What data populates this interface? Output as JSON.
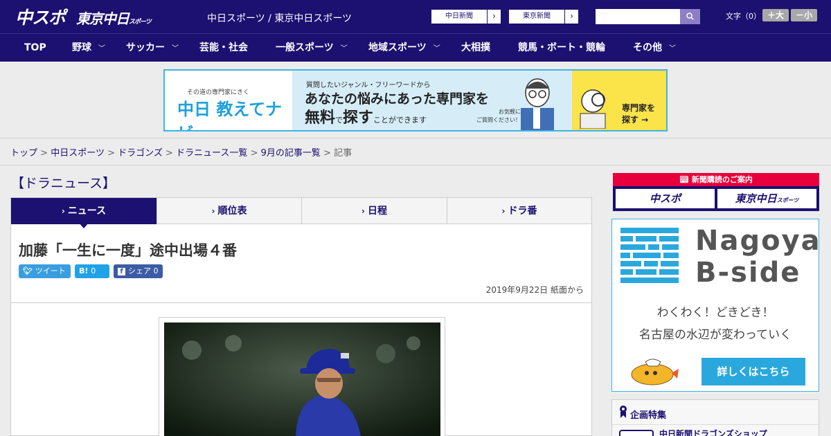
{
  "header": {
    "logo_chuspo": "中スポ",
    "logo_tokyo": "東京中日",
    "logo_tokyo_small": "スポーツ",
    "tagline": "中日スポーツ / 東京中日スポーツ",
    "btn_chunichi": "中日新聞",
    "btn_tokyo": "東京新聞",
    "search_placeholder": "",
    "font_size_label": "文字（0）",
    "font_plus": "＋大",
    "font_minus": "－小"
  },
  "nav": {
    "items": [
      {
        "label": "TOP"
      },
      {
        "label": "野球"
      },
      {
        "label": "サッカー"
      },
      {
        "label": "芸能・社会"
      },
      {
        "label": "一般スポーツ"
      },
      {
        "label": "地域スポーツ"
      },
      {
        "label": "大相撲"
      },
      {
        "label": "競馬・ボート・競輪"
      },
      {
        "label": "その他"
      }
    ]
  },
  "ad": {
    "sub": "その道の専門家にきく",
    "navi": "中日 教えてナビ",
    "question": "質問したいジャンル・フリーワードから",
    "headline1": "あなたの悩みにあった専門家を",
    "headline2_a": "無料",
    "headline2_b": "で",
    "headline2_c": "探す",
    "headline2_d": "ことができます",
    "kigaru1": "お気軽に",
    "kigaru2": "ご質問ください！",
    "explore1": "専門家を",
    "explore2": "探す →"
  },
  "breadcrumb": {
    "items": [
      "トップ",
      "中日スポーツ",
      "ドラゴンズ",
      "ドラニュース一覧",
      "9月の記事一覧"
    ],
    "current": "記事",
    "sep": ">"
  },
  "section_title": "【ドラニュース】",
  "tabs": [
    {
      "label": "ニュース"
    },
    {
      "label": "順位表"
    },
    {
      "label": "日程"
    },
    {
      "label": "ドラ番"
    }
  ],
  "article": {
    "title": "加藤「一生に一度」途中出場４番",
    "tweet": "ツイート",
    "hatena": "0",
    "share": "シェア 0",
    "date": "2019年9月22日 紙面から"
  },
  "sidebar": {
    "subscription_title": "新聞購読のご案内",
    "sub_chuspo": "中スポ",
    "sub_tokyo": "東京中日",
    "sub_tokyo_small": "スポーツ",
    "bside_title1": "Nagoya",
    "bside_title2": "B-side",
    "bside_text1": "わくわく！どきどき！",
    "bside_text2": "名古屋の水辺が変わっていく",
    "bside_button": "詳しくはこちら",
    "kikaku_title": "企画特集",
    "kikaku_item": "中日新聞ドラゴンズショップ"
  },
  "colors": {
    "brand": "#1c1070",
    "accent_blue": "#2aa8dd",
    "accent_red": "#e8003c",
    "ad_yellow": "#fbe34a"
  }
}
